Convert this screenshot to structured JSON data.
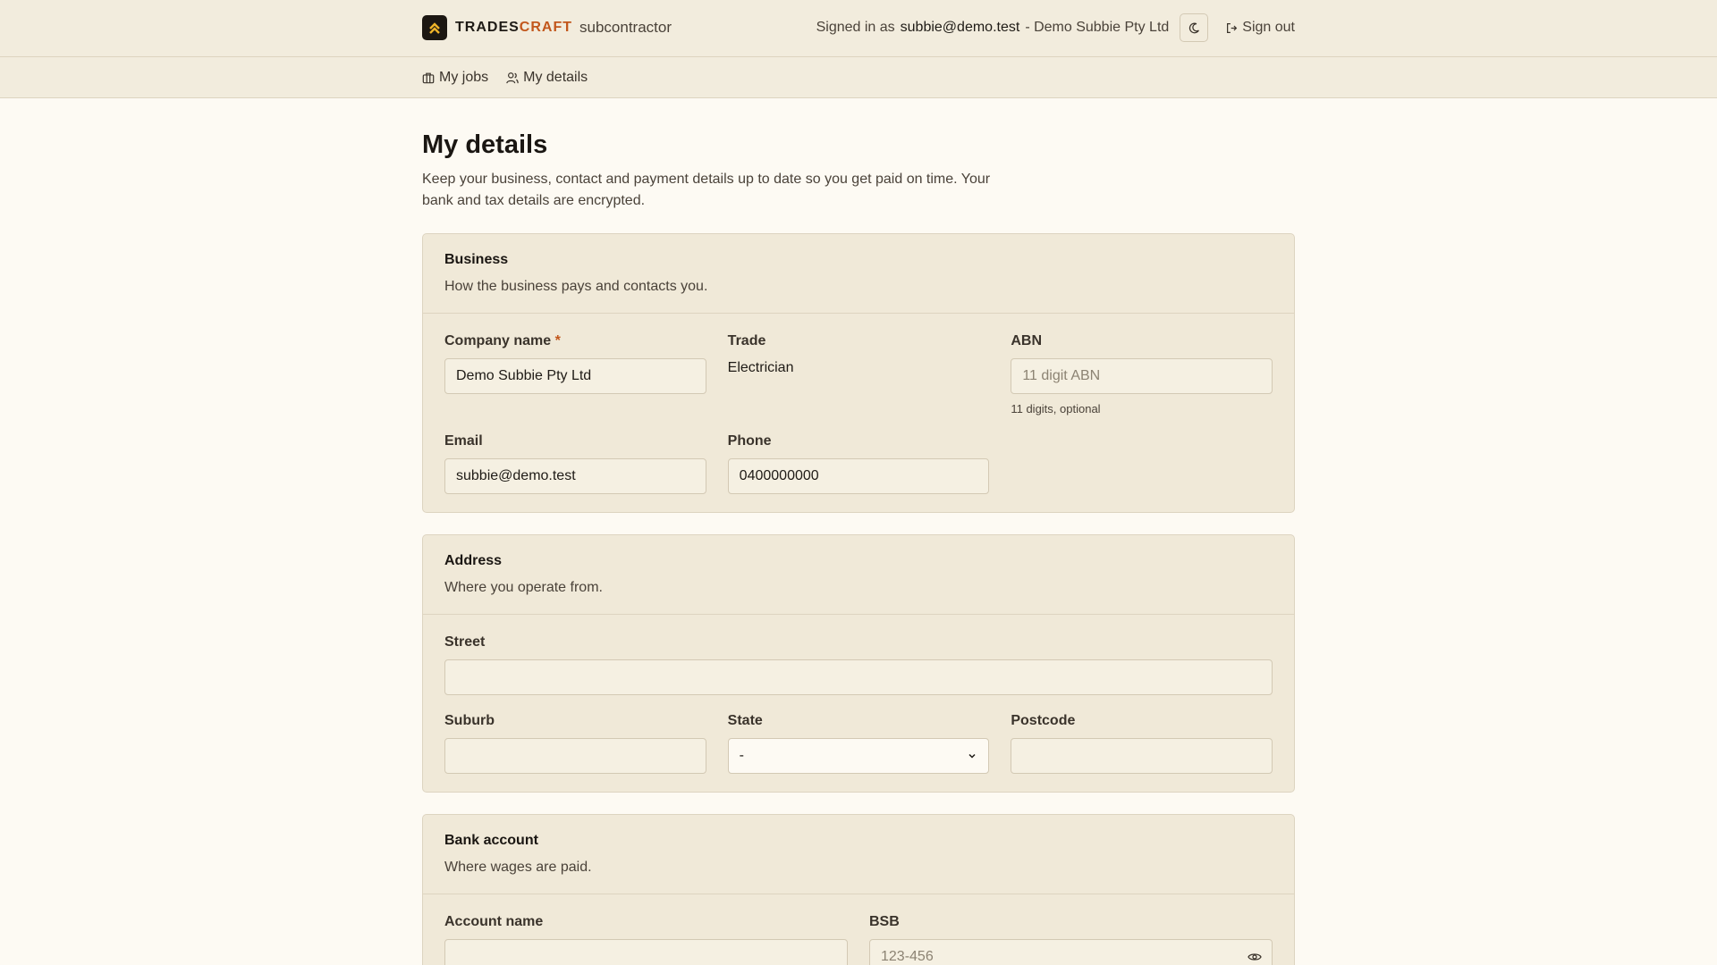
{
  "header": {
    "brand_part1": "TRADES",
    "brand_part2": "CRAFT",
    "brand_sub": "subcontractor",
    "signed_in_prefix": "Signed in as",
    "user_email": "subbie@demo.test",
    "company_suffix": "- Demo Subbie Pty Ltd",
    "sign_out": "Sign out"
  },
  "nav": {
    "items": [
      {
        "label": "My jobs",
        "icon": "briefcase-icon"
      },
      {
        "label": "My details",
        "icon": "users-icon"
      }
    ]
  },
  "page": {
    "title": "My details",
    "intro": "Keep your business, contact and payment details up to date so you get paid on time. Your bank and tax details are encrypted."
  },
  "business": {
    "title": "Business",
    "desc": "How the business pays and contacts you.",
    "company_label": "Company name",
    "required_mark": "*",
    "company_value": "Demo Subbie Pty Ltd",
    "trade_label": "Trade",
    "trade_value": "Electrician",
    "abn_label": "ABN",
    "abn_placeholder": "11 digit ABN",
    "abn_hint": "11 digits, optional",
    "email_label": "Email",
    "email_value": "subbie@demo.test",
    "phone_label": "Phone",
    "phone_value": "0400000000"
  },
  "address": {
    "title": "Address",
    "desc": "Where you operate from.",
    "street_label": "Street",
    "suburb_label": "Suburb",
    "state_label": "State",
    "state_value": "-",
    "postcode_label": "Postcode"
  },
  "bank": {
    "title": "Bank account",
    "desc": "Where wages are paid.",
    "account_name_label": "Account name",
    "bsb_label": "BSB",
    "bsb_placeholder": "123-456"
  },
  "colors": {
    "accent": "#c2571c",
    "header_bg": "#f2ecdd",
    "page_bg": "#fdfaf3"
  }
}
